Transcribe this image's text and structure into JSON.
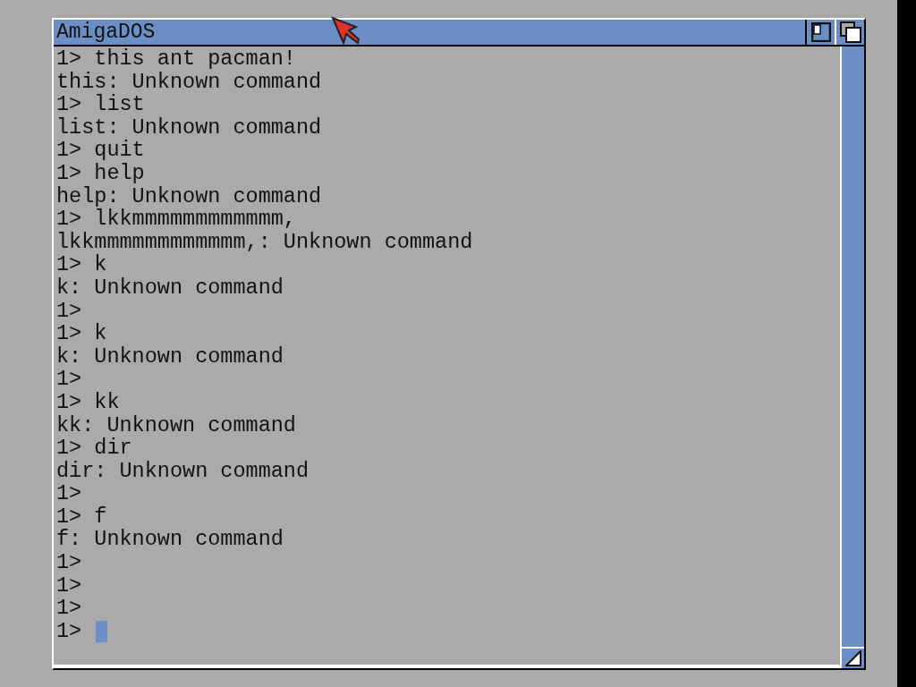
{
  "window": {
    "title": "AmigaDOS"
  },
  "console": {
    "lines": [
      "1> this ant pacman!",
      "this: Unknown command",
      "1> list",
      "list: Unknown command",
      "1> quit",
      "1> help",
      "help: Unknown command",
      "1> lkkmmmmmmmmmmmm,",
      "lkkmmmmmmmmmmmm,: Unknown command",
      "1> k",
      "k: Unknown command",
      "1>",
      "1> k",
      "k: Unknown command",
      "1>",
      "1> kk",
      "kk: Unknown command",
      "1> dir",
      "dir: Unknown command",
      "1>",
      "1> f",
      "f: Unknown command",
      "1>",
      "1>",
      "1>",
      "1>"
    ],
    "cursor": true
  }
}
